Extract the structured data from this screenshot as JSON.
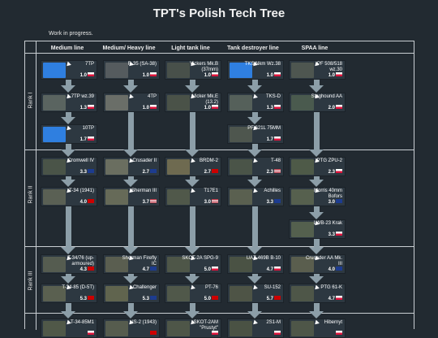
{
  "title": "TPT's Polish Tech Tree",
  "note": "Work in progress.",
  "columns": [
    "Medium line",
    "Medium/ Heavy line",
    "Light tank line",
    "Tank destroyer line",
    "SPAA line"
  ],
  "ranks": [
    "Rank I",
    "Rank II",
    "Rank III"
  ],
  "colors": {
    "background": "#222a31",
    "grid_line": "#c9ced3",
    "arrow": "#8c9ea8",
    "card_bg": "#2d3841"
  },
  "cards": [
    {
      "name": "7TP",
      "br": "1.0",
      "flag": "pl",
      "thumb": "#2f7fe0"
    },
    {
      "name": "R-35 (SA-38)",
      "br": "1.0",
      "flag": "pl",
      "thumb": "#555b5e"
    },
    {
      "name": "Vickers Mk.B (37mm)",
      "br": "1.0",
      "flag": "pl",
      "thumb": "#48504a"
    },
    {
      "name": "TKS Nkm Wz.38",
      "br": "1.0",
      "flag": "pl",
      "thumb": "#2f7fe0"
    },
    {
      "name": "PF 508/518 wz.30",
      "br": "1.0",
      "flag": "pl",
      "thumb": "#4e5650"
    },
    {
      "name": "7TP wz.39",
      "br": "1.3",
      "flag": "pl",
      "thumb": "#5a6460"
    },
    {
      "name": "4TP",
      "br": "1.0",
      "flag": "pl",
      "thumb": "#6a6e68"
    },
    {
      "name": "Vicker Mk.E (13.2)",
      "br": "1.0",
      "flag": "pl",
      "thumb": "#4a5248"
    },
    {
      "name": "TKS-D",
      "br": "1.3",
      "flag": "pl",
      "thumb": "#55605a"
    },
    {
      "name": "Staghound AA",
      "br": "2.0",
      "flag": "pl",
      "thumb": "#4a5a4e"
    },
    {
      "name": "10TP",
      "br": "1.7",
      "flag": "pl",
      "thumb": "#2f7fe0"
    },
    {
      "name": "PF 621L 75MM",
      "br": "1.7",
      "flag": "pl",
      "thumb": "#4e564e"
    },
    {
      "name": "Cromwell IV",
      "br": "3.3",
      "flag": "gb",
      "thumb": "#4a5448"
    },
    {
      "name": "Crusader II",
      "br": "2.7",
      "flag": "gb",
      "thumb": "#6a6e60"
    },
    {
      "name": "BRDM-2",
      "br": "2.7",
      "flag": "su",
      "thumb": "#6e6a50"
    },
    {
      "name": "T-48",
      "br": "2.3",
      "flag": "us",
      "thumb": "#4a5448"
    },
    {
      "name": "PTG ZPU-2",
      "br": "2.3",
      "flag": "pl",
      "thumb": "#4e5a48"
    },
    {
      "name": "T-34 (1941)",
      "br": "4.0",
      "flag": "su",
      "thumb": "#5a6054"
    },
    {
      "name": "Sherman III",
      "br": "3.7",
      "flag": "us",
      "thumb": "#666a58"
    },
    {
      "name": "T17E1",
      "br": "3.0",
      "flag": "us",
      "thumb": "#50584a"
    },
    {
      "name": "Achilles",
      "br": "3.3",
      "flag": "gb",
      "thumb": "#5a6050"
    },
    {
      "name": "Morris 40mm Bofors",
      "br": "3.0",
      "flag": "gb",
      "thumb": "#56604e"
    },
    {
      "name": "LWB-23 Krak",
      "br": "3.3",
      "flag": "pl",
      "thumb": "#54604e"
    },
    {
      "name": "T-34/76 (up-armoured)",
      "br": "4.3",
      "flag": "su",
      "thumb": "#555c50"
    },
    {
      "name": "Sherman Firefly IC",
      "br": "4.7",
      "flag": "gb",
      "thumb": "#5a5e50"
    },
    {
      "name": "SKOT-2A SPG-9",
      "br": "5.0",
      "flag": "pl",
      "thumb": "#4e5648"
    },
    {
      "name": "UAZ-469B B-10",
      "br": "4.7",
      "flag": "pl",
      "thumb": "#4a5244"
    },
    {
      "name": "Crusader AA Mk. III",
      "br": "4.0",
      "flag": "gb",
      "thumb": "#5a5e4e"
    },
    {
      "name": "T-34-85 (D-5T)",
      "br": "5.3",
      "flag": "su",
      "thumb": "#5a6050"
    },
    {
      "name": "Challenger",
      "br": "5.3",
      "flag": "gb",
      "thumb": "#60644e"
    },
    {
      "name": "PT-76",
      "br": "5.0",
      "flag": "su",
      "thumb": "#50584a"
    },
    {
      "name": "SU-152",
      "br": "5.7",
      "flag": "su",
      "thumb": "#4e5446"
    },
    {
      "name": "PTG 61-K",
      "br": "4.7",
      "flag": "pl",
      "thumb": "#4e5648"
    },
    {
      "name": "T-34-85M1",
      "br": "",
      "flag": "pl",
      "thumb": "#505848"
    },
    {
      "name": "IS-2 (1943)",
      "br": "",
      "flag": "su",
      "thumb": "#565c4e"
    },
    {
      "name": "SKOT-2AM \"Prustyt\"",
      "br": "",
      "flag": "pl",
      "thumb": "#4e5648"
    },
    {
      "name": "2S1-M",
      "br": "",
      "flag": "pl",
      "thumb": "#4a5244"
    },
    {
      "name": "Hibernyt",
      "br": "",
      "flag": "pl",
      "thumb": "#4e5648"
    }
  ]
}
